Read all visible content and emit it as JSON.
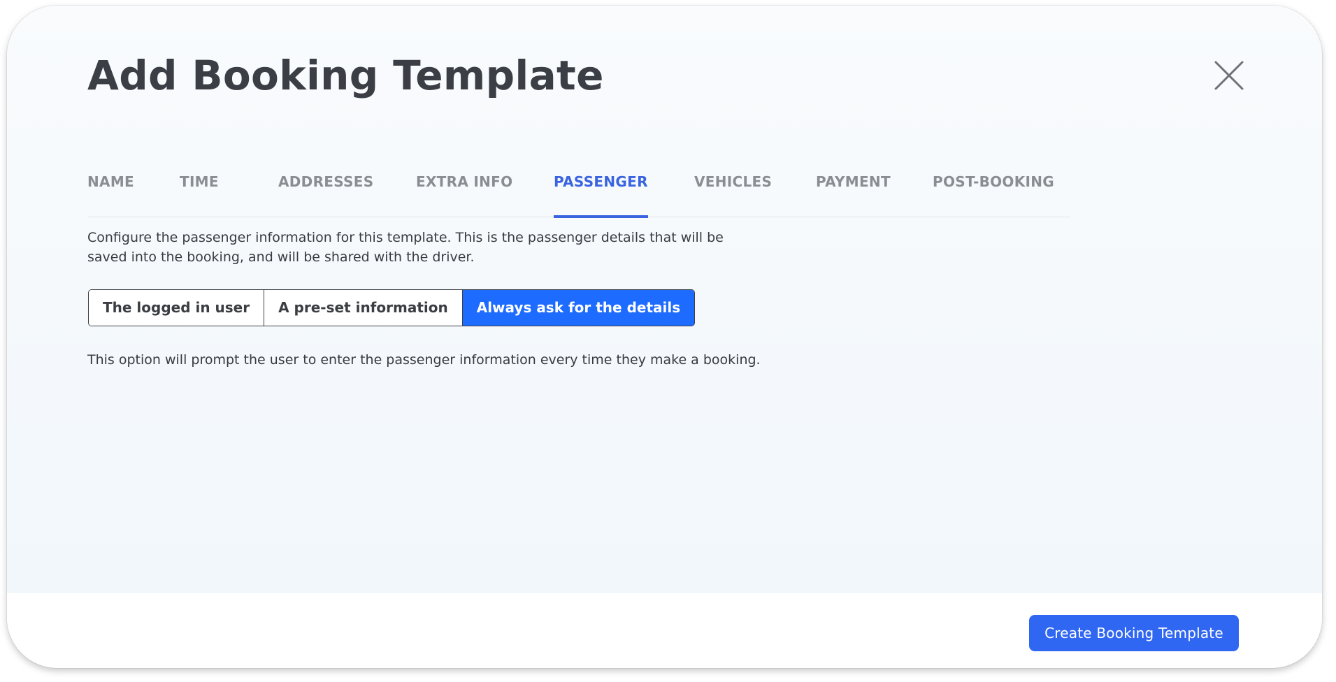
{
  "modal": {
    "title": "Add Booking Template",
    "close_icon": "close-icon"
  },
  "tabs": [
    {
      "label": "NAME",
      "active": false
    },
    {
      "label": "TIME",
      "active": false
    },
    {
      "label": "ADDRESSES",
      "active": false
    },
    {
      "label": "EXTRA INFO",
      "active": false
    },
    {
      "label": "PASSENGER",
      "active": true
    },
    {
      "label": "VEHICLES",
      "active": false
    },
    {
      "label": "PAYMENT",
      "active": false
    },
    {
      "label": "POST-BOOKING",
      "active": false
    }
  ],
  "passenger": {
    "description": "Configure the passenger information for this template. This is the passenger details that will be saved into the booking, and will be shared with the driver.",
    "options": [
      {
        "label": "The logged in user",
        "selected": false
      },
      {
        "label": "A pre-set information",
        "selected": false
      },
      {
        "label": "Always ask for the details",
        "selected": true
      }
    ],
    "hint": "This option will prompt the user to enter the passenger information every time they make a booking."
  },
  "footer": {
    "create_label": "Create Booking Template"
  },
  "colors": {
    "accent": "#3a63e0",
    "selected_option": "#1e6bff",
    "primary_button": "#2f66f2",
    "title_text": "#3b3f45",
    "inactive_tab": "#8a8d92"
  }
}
